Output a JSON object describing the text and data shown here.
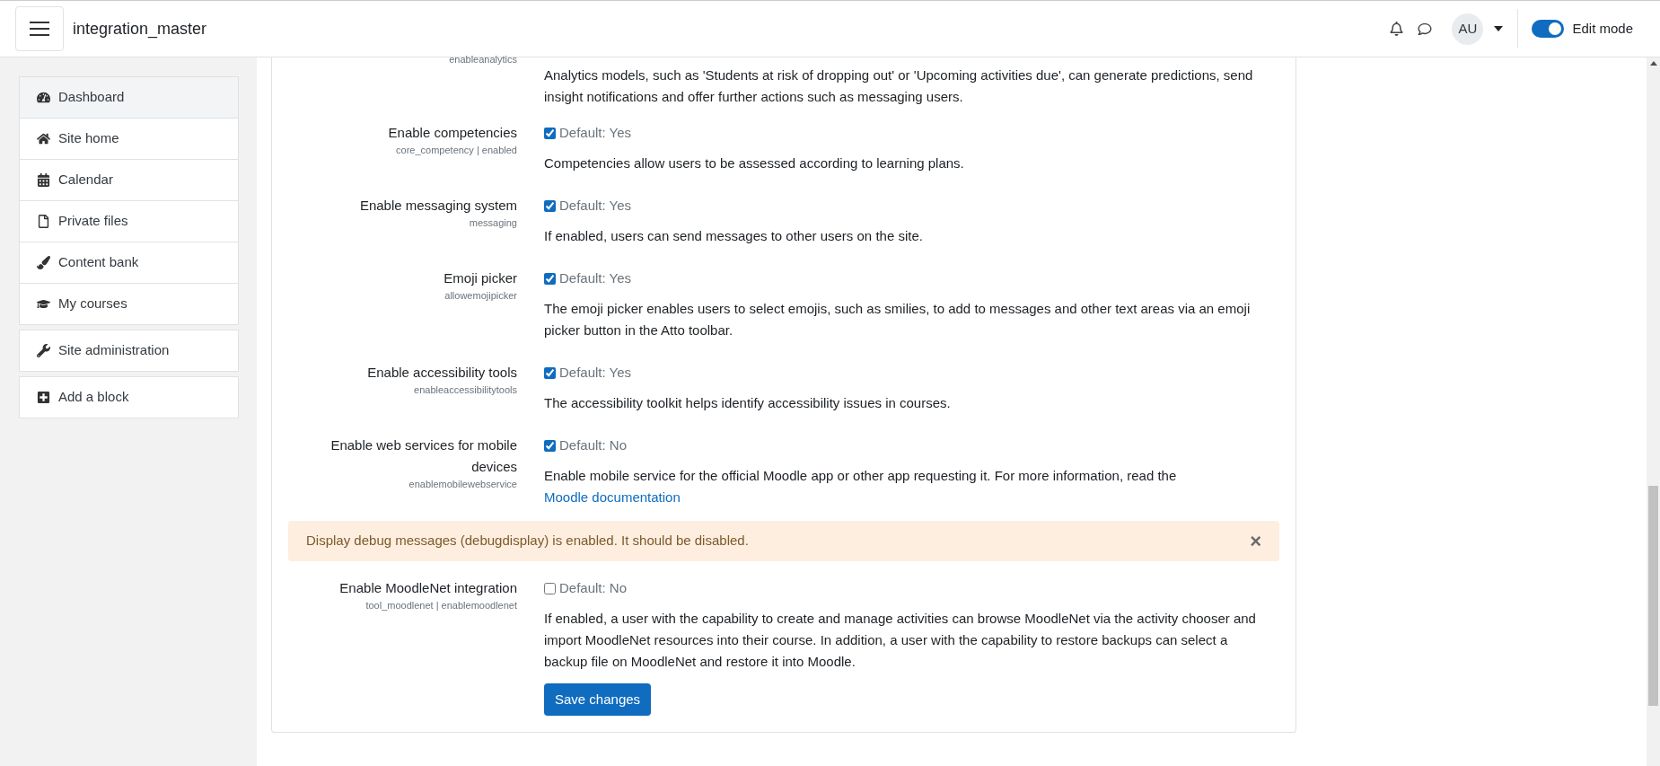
{
  "header": {
    "site_name": "integration_master",
    "avatar_initials": "AU",
    "edit_mode": {
      "label": "Edit mode",
      "on": true
    }
  },
  "sidebar": {
    "nav": [
      {
        "label": "Dashboard",
        "selected": true
      },
      {
        "label": "Site home",
        "selected": false
      },
      {
        "label": "Calendar",
        "selected": false
      },
      {
        "label": "Private files",
        "selected": false
      },
      {
        "label": "Content bank",
        "selected": false
      },
      {
        "label": "My courses",
        "selected": false
      }
    ],
    "blocks": [
      {
        "label": "Site administration"
      },
      {
        "label": "Add a block"
      }
    ]
  },
  "partial_setting": {
    "code": "enableanalytics",
    "description": "Analytics models, such as 'Students at risk of dropping out' or 'Upcoming activities due', can generate predictions, send insight notifications and offer further actions such as messaging users."
  },
  "settings": [
    {
      "label": "Enable competencies",
      "code": "core_competency | enabled",
      "checked": true,
      "default": "Default: Yes",
      "description": "Competencies allow users to be assessed according to learning plans."
    },
    {
      "label": "Enable messaging system",
      "code": "messaging",
      "checked": true,
      "default": "Default: Yes",
      "description": "If enabled, users can send messages to other users on the site."
    },
    {
      "label": "Emoji picker",
      "code": "allowemojipicker",
      "checked": true,
      "default": "Default: Yes",
      "description": "The emoji picker enables users to select emojis, such as smilies, to add to messages and other text areas via an emoji picker button in the Atto toolbar."
    },
    {
      "label": "Enable accessibility tools",
      "code": "enableaccessibilitytools",
      "checked": true,
      "default": "Default: Yes",
      "description": "The accessibility toolkit helps identify accessibility issues in courses."
    },
    {
      "label": "Enable web services for mobile devices",
      "code": "enablemobilewebservice",
      "checked": true,
      "default": "Default: No",
      "description": "Enable mobile service for the official Moodle app or other app requesting it. For more information, read the",
      "link": "Moodle documentation"
    }
  ],
  "alert": {
    "message": "Display debug messages (debugdisplay) is enabled. It should be disabled.",
    "close": "×"
  },
  "settings_after": [
    {
      "label": "Enable MoodleNet integration",
      "code": "tool_moodlenet | enablemoodlenet",
      "checked": false,
      "default": "Default: No",
      "description": "If enabled, a user with the capability to create and manage activities can browse MoodleNet via the activity chooser and import MoodleNet resources into their course. In addition, a user with the capability to restore backups can select a backup file on MoodleNet and restore it into Moodle."
    }
  ],
  "save_button": "Save changes"
}
